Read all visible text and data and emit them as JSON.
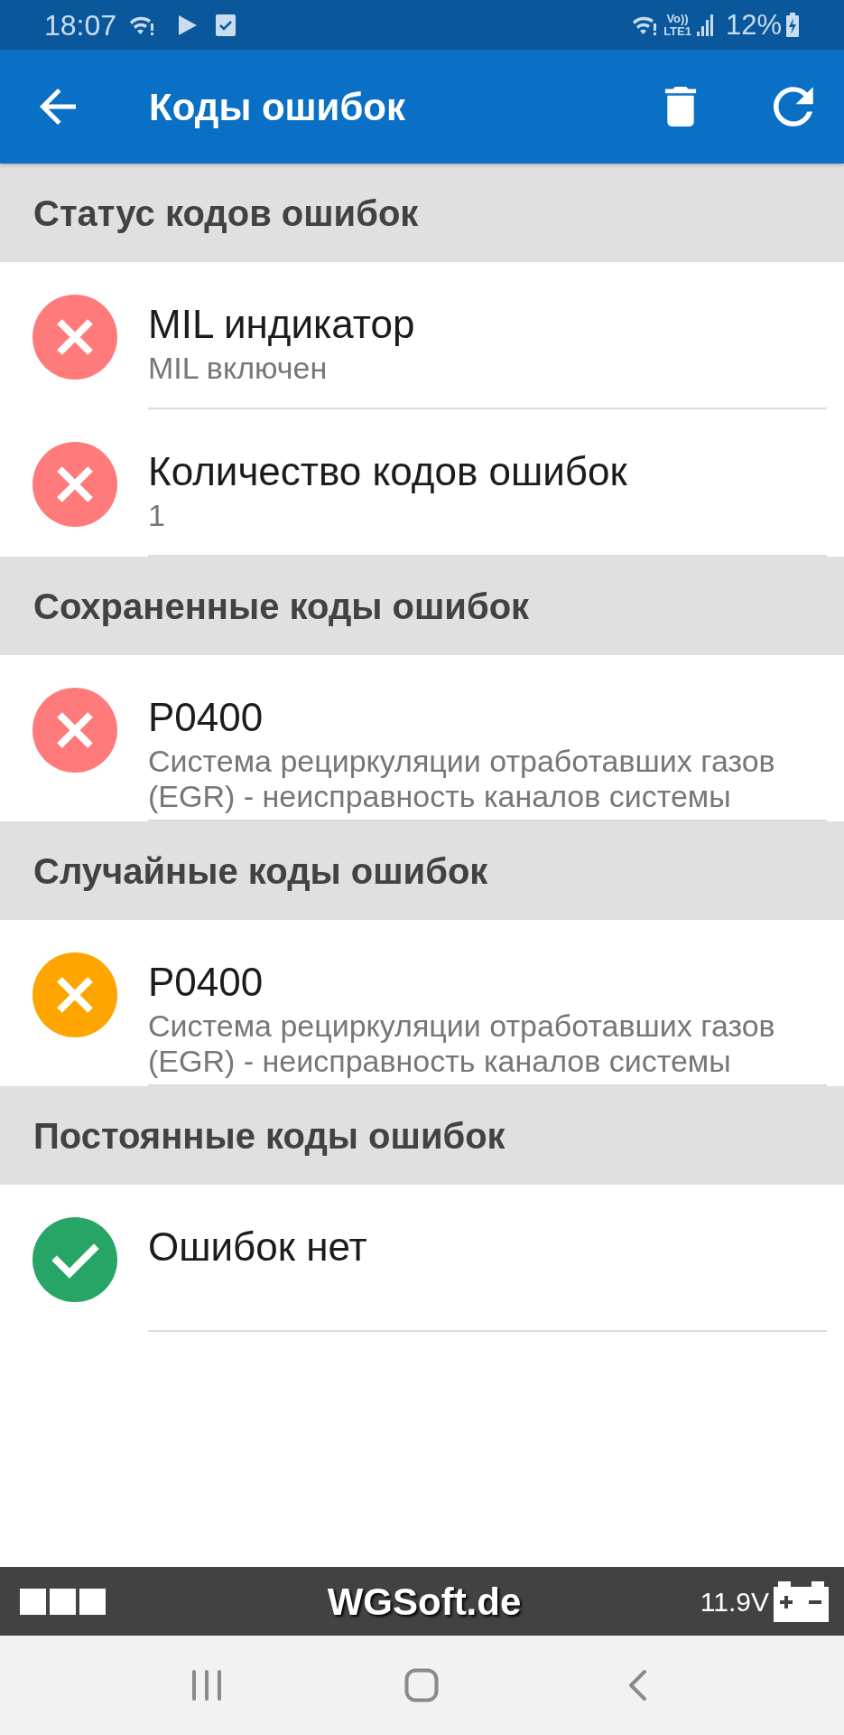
{
  "status_bar": {
    "time": "18:07",
    "volte": "Vo))",
    "lte": "LTE1",
    "battery": "12%"
  },
  "app_bar": {
    "title": "Коды ошибок"
  },
  "sections": [
    {
      "title": "Статус кодов ошибок",
      "items": [
        {
          "kind": "fault",
          "color": "#ff7b7b",
          "title": "MIL индикатор",
          "subtitle": "MIL включен"
        },
        {
          "kind": "fault",
          "color": "#ff7b7b",
          "title": "Количество кодов ошибок",
          "subtitle": "1"
        }
      ]
    },
    {
      "title": "Сохраненные коды ошибок",
      "items": [
        {
          "kind": "fault",
          "color": "#ff7b7b",
          "title": "P0400",
          "subtitle": "Система рециркуляции отработавших газов (EGR) - неисправность каналов системы"
        }
      ]
    },
    {
      "title": "Случайные коды ошибок",
      "items": [
        {
          "kind": "fault",
          "color": "#ffa500",
          "title": "P0400",
          "subtitle": "Система рециркуляции отработавших газов (EGR) - неисправность каналов системы"
        }
      ]
    },
    {
      "title": "Постоянные коды ошибок",
      "items": [
        {
          "kind": "ok",
          "color": "#27a567",
          "title": "Ошибок нет"
        }
      ]
    }
  ],
  "footer": {
    "brand": "WGSoft.de",
    "voltage": "11.9V"
  }
}
